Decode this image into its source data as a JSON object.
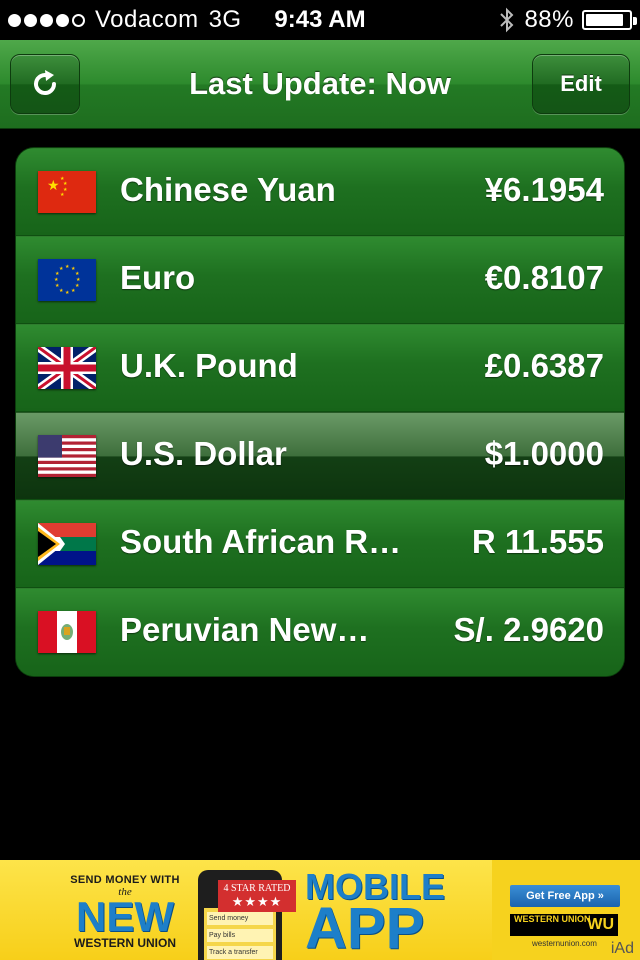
{
  "status_bar": {
    "carrier": "Vodacom",
    "network": "3G",
    "time": "9:43 AM",
    "battery": "88%",
    "battery_level": 0.88,
    "signal_bars": 4,
    "signal_max": 5
  },
  "navbar": {
    "title": "Last Update: Now",
    "edit_label": "Edit",
    "refresh_icon": "refresh-icon"
  },
  "currencies": [
    {
      "flag": "cn",
      "name": "Chinese Yuan",
      "value": "¥6.1954",
      "selected": false
    },
    {
      "flag": "eu",
      "name": "Euro",
      "value": "€0.8107",
      "selected": false
    },
    {
      "flag": "gb",
      "name": "U.K. Pound",
      "value": "£0.6387",
      "selected": false
    },
    {
      "flag": "us",
      "name": "U.S. Dollar",
      "value": "$1.0000",
      "selected": true
    },
    {
      "flag": "za",
      "name": "South African R…",
      "value": "R 11.555",
      "selected": false
    },
    {
      "flag": "pe",
      "name": "Peruvian New…",
      "value": "S/. 2.9620",
      "selected": false
    }
  ],
  "ad": {
    "send_money": "SEND MONEY WITH",
    "the": "the",
    "new": "NEW",
    "western_union": "WESTERN UNION",
    "star_rated": "4 STAR RATED",
    "stars": "★★★★",
    "mobile": "MOBILE",
    "app": "APP",
    "cta": "Get Free App »",
    "logo_text": "WESTERN UNION",
    "logo_mark": "WU",
    "url": "westernunion.com",
    "phone_items": [
      "Send money",
      "Pay bills",
      "Track a transfer"
    ],
    "iad": "iAd"
  },
  "colors": {
    "nav_green": "#2d8a2d",
    "row_green": "#1e7020",
    "ad_yellow": "#f7cf19",
    "ad_blue": "#1d7fc9"
  }
}
